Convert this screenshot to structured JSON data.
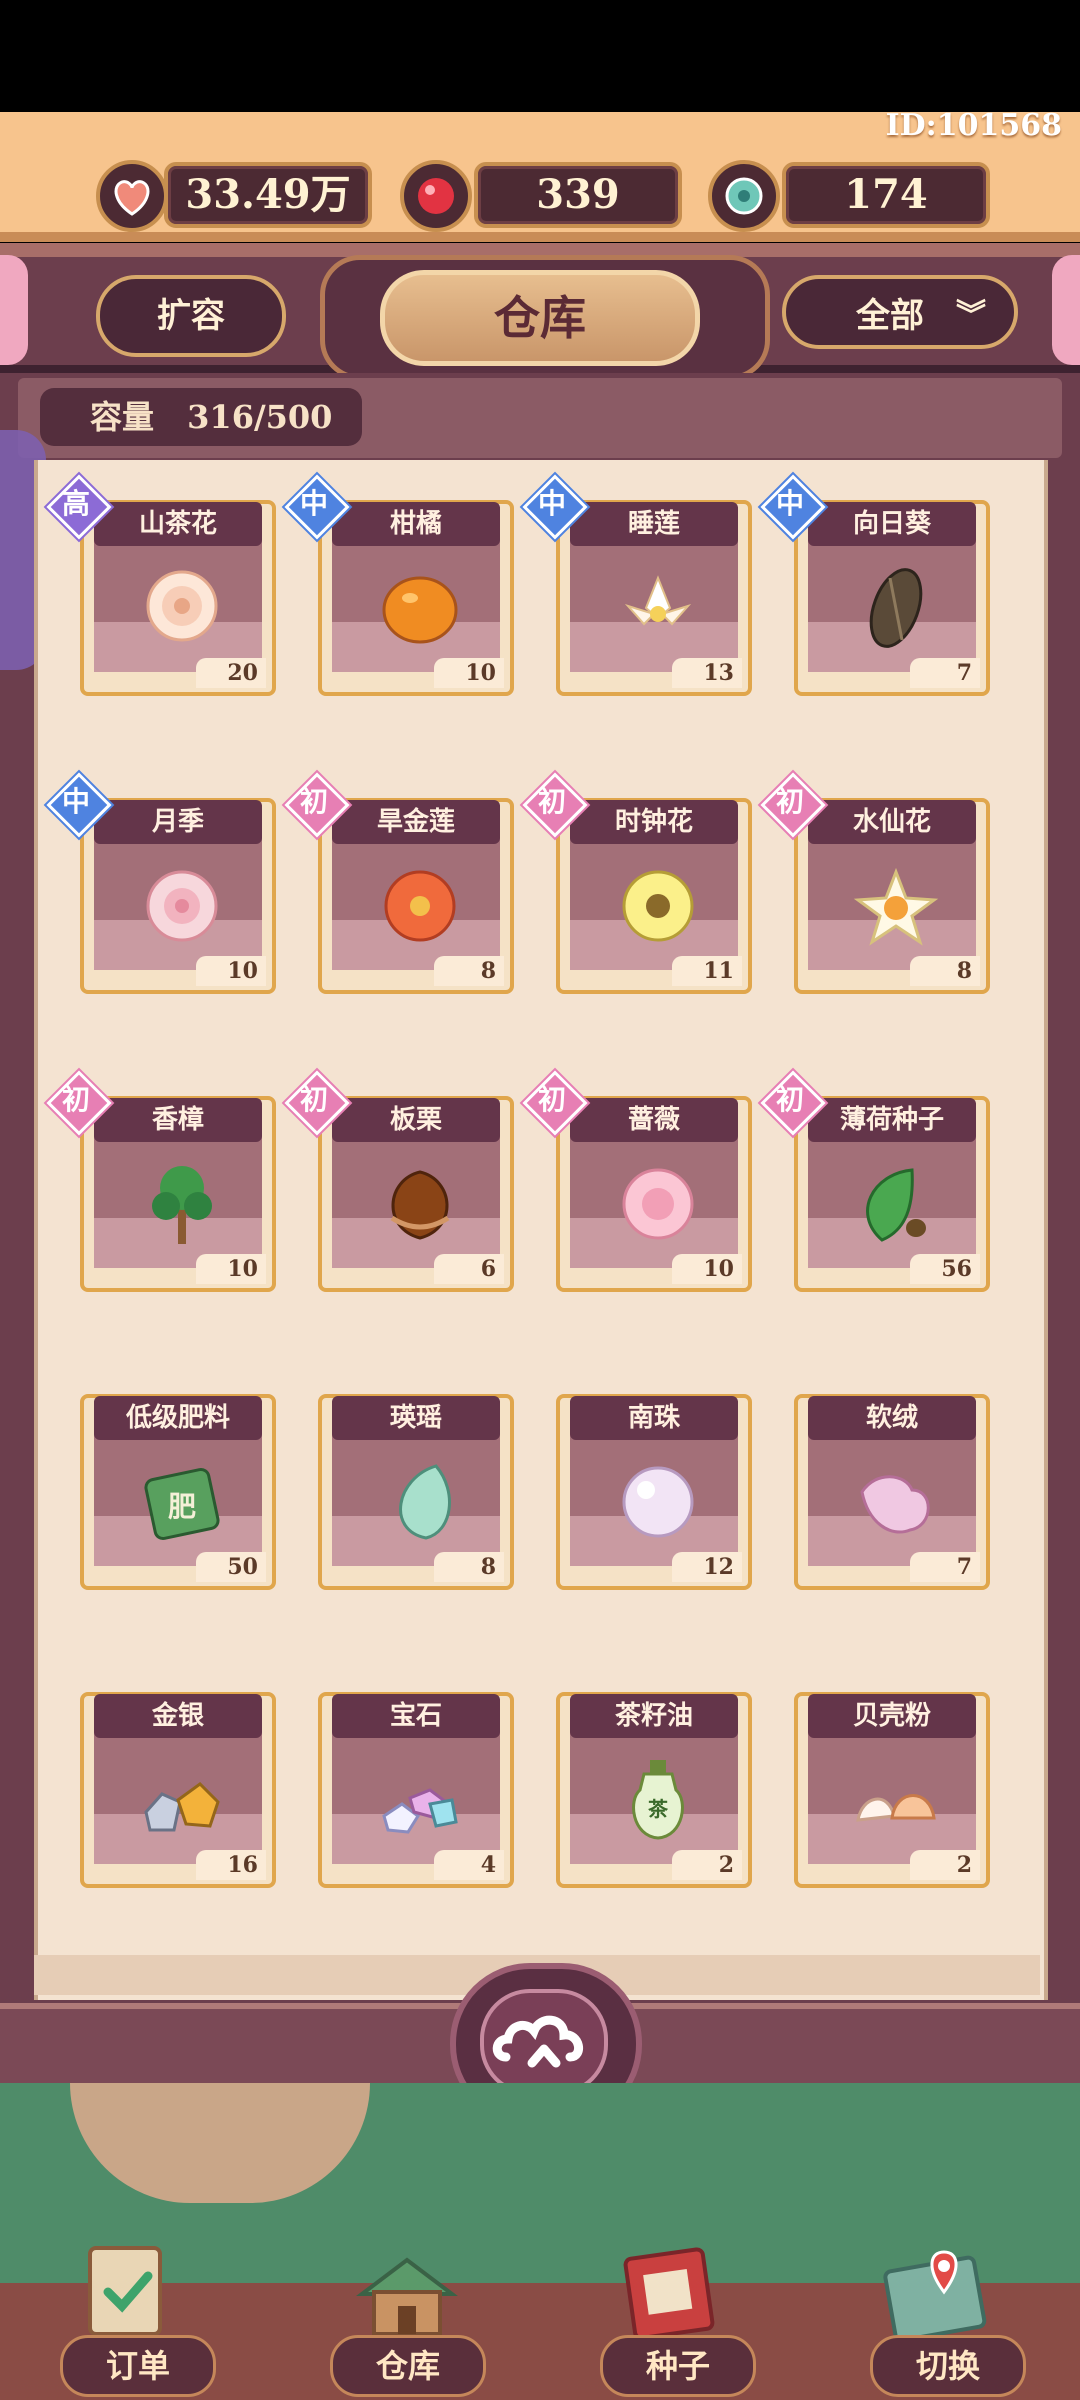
{
  "user": {
    "id_text": "ID:101568"
  },
  "resources": [
    {
      "icon": "heart-shell-icon",
      "value": "33.49万"
    },
    {
      "icon": "red-gem-icon",
      "value": "339"
    },
    {
      "icon": "teal-jade-icon",
      "value": "174"
    }
  ],
  "header": {
    "expand_label": "扩容",
    "title": "仓库",
    "filter_label": "全部"
  },
  "capacity": {
    "label": "容量",
    "value": "316/500"
  },
  "items": [
    {
      "name": "山茶花",
      "count": "20",
      "grade": "高",
      "grade_color": "#8c6bd6",
      "icon": "camellia-icon"
    },
    {
      "name": "柑橘",
      "count": "10",
      "grade": "中",
      "grade_color": "#4f83e0",
      "icon": "tangerine-icon"
    },
    {
      "name": "睡莲",
      "count": "13",
      "grade": "中",
      "grade_color": "#4f83e0",
      "icon": "water-lily-icon"
    },
    {
      "name": "向日葵",
      "count": "7",
      "grade": "中",
      "grade_color": "#4f83e0",
      "icon": "sunflower-seed-icon"
    },
    {
      "name": "月季",
      "count": "10",
      "grade": "中",
      "grade_color": "#4f83e0",
      "icon": "rose-icon"
    },
    {
      "name": "旱金莲",
      "count": "8",
      "grade": "初",
      "grade_color": "#e77fb4",
      "icon": "nasturtium-icon"
    },
    {
      "name": "时钟花",
      "count": "11",
      "grade": "初",
      "grade_color": "#e77fb4",
      "icon": "clock-flower-icon"
    },
    {
      "name": "水仙花",
      "count": "8",
      "grade": "初",
      "grade_color": "#e77fb4",
      "icon": "narcissus-icon"
    },
    {
      "name": "香樟",
      "count": "10",
      "grade": "初",
      "grade_color": "#e77fb4",
      "icon": "camphor-tree-icon"
    },
    {
      "name": "板栗",
      "count": "6",
      "grade": "初",
      "grade_color": "#e77fb4",
      "icon": "chestnut-icon"
    },
    {
      "name": "蔷薇",
      "count": "10",
      "grade": "初",
      "grade_color": "#e77fb4",
      "icon": "pink-rose-icon"
    },
    {
      "name": "薄荷种子",
      "count": "56",
      "grade": "初",
      "grade_color": "#e77fb4",
      "icon": "mint-seed-icon"
    },
    {
      "name": "低级肥料",
      "count": "50",
      "grade": "",
      "icon": "fertilizer-bag-icon"
    },
    {
      "name": "瑛瑶",
      "count": "8",
      "grade": "",
      "icon": "jade-crescent-icon"
    },
    {
      "name": "南珠",
      "count": "12",
      "grade": "",
      "icon": "pearl-icon"
    },
    {
      "name": "软绒",
      "count": "7",
      "grade": "",
      "icon": "soft-fluff-icon"
    },
    {
      "name": "金银",
      "count": "16",
      "grade": "",
      "icon": "gold-silver-ore-icon"
    },
    {
      "name": "宝石",
      "count": "4",
      "grade": "",
      "icon": "gemstones-icon"
    },
    {
      "name": "茶籽油",
      "count": "2",
      "grade": "",
      "icon": "tea-oil-bottle-icon"
    },
    {
      "name": "贝壳粉",
      "count": "2",
      "grade": "",
      "icon": "shell-powder-icon"
    }
  ],
  "bottom_nav": [
    {
      "label": "订单",
      "icon": "order-clipboard-icon"
    },
    {
      "label": "仓库",
      "icon": "warehouse-icon"
    },
    {
      "label": "种子",
      "icon": "seed-book-icon"
    },
    {
      "label": "切换",
      "icon": "map-switch-icon"
    }
  ]
}
